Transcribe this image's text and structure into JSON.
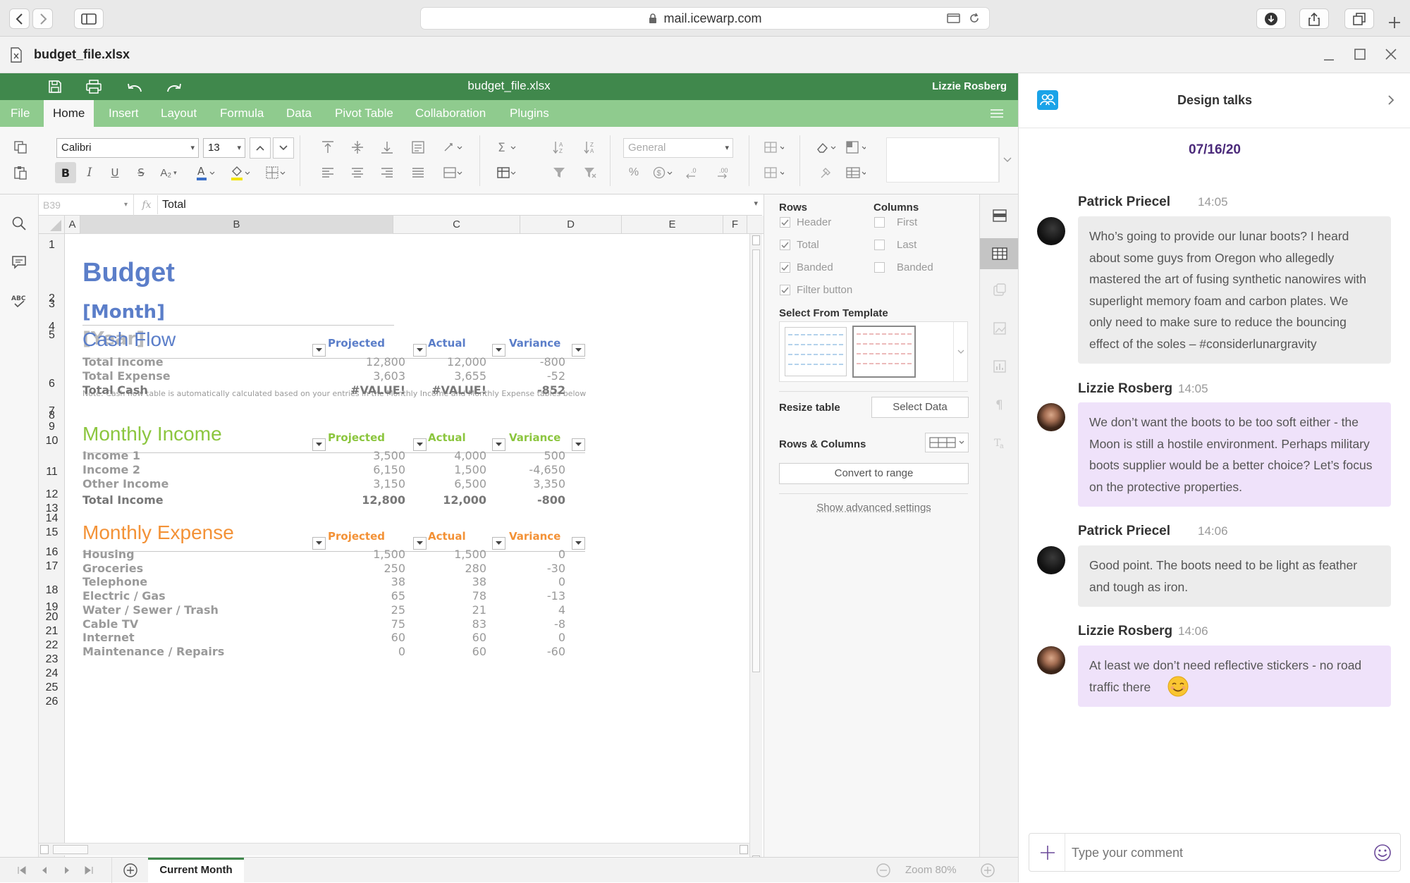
{
  "browser": {
    "url": "mail.icewarp.com"
  },
  "app": {
    "file_name": "budget_file.xlsx"
  },
  "editor": {
    "title": "budget_file.xlsx",
    "user": "Lizzie Rosberg",
    "tabs": [
      "File",
      "Home",
      "Insert",
      "Layout",
      "Formula",
      "Data",
      "Pivot Table",
      "Collaboration",
      "Plugins"
    ],
    "active_tab": "Home",
    "font_name": "Calibri",
    "font_size": "13",
    "number_format": "General",
    "cell_ref": "B39",
    "fx_label": "fx",
    "formula_value": "Total"
  },
  "columns": [
    "A",
    "B",
    "C",
    "D",
    "E",
    "F"
  ],
  "rows": [
    "1",
    "2",
    "3",
    "4",
    "5",
    "6",
    "7",
    "8",
    "9",
    "10",
    "11",
    "12",
    "13",
    "14",
    "15",
    "16",
    "17",
    "18",
    "19",
    "20",
    "21",
    "22",
    "23",
    "24",
    "25",
    "26"
  ],
  "sheet": {
    "title": "Budget",
    "month": "[Month]",
    "year": "[Year]",
    "note": "Note: Cash flow table is automatically calculated based on your entries in the Monthly Income and Monthly Expense tables below",
    "col_projected": "Projected",
    "col_actual": "Actual",
    "col_variance": "Variance",
    "cash_flow": {
      "title": "Cash Flow",
      "rows": [
        {
          "label": "Total Income",
          "projected": "12,800",
          "actual": "12,000",
          "variance": "-800"
        },
        {
          "label": "Total Expense",
          "projected": "3,603",
          "actual": "3,655",
          "variance": "-52"
        },
        {
          "label": "Total Cash",
          "projected": "#VALUE!",
          "actual": "#VALUE!",
          "variance": "-852"
        }
      ]
    },
    "income": {
      "title": "Monthly Income",
      "rows": [
        {
          "label": "Income 1",
          "projected": "3,500",
          "actual": "4,000",
          "variance": "500"
        },
        {
          "label": "Income 2",
          "projected": "6,150",
          "actual": "1,500",
          "variance": "-4,650"
        },
        {
          "label": "Other Income",
          "projected": "3,150",
          "actual": "6,500",
          "variance": "3,350"
        }
      ],
      "total": {
        "label": "Total Income",
        "projected": "12,800",
        "actual": "12,000",
        "variance": "-800"
      }
    },
    "expense": {
      "title": "Monthly Expense",
      "rows": [
        {
          "label": "Housing",
          "projected": "1,500",
          "actual": "1,500",
          "variance": "0"
        },
        {
          "label": "Groceries",
          "projected": "250",
          "actual": "280",
          "variance": "-30"
        },
        {
          "label": "Telephone",
          "projected": "38",
          "actual": "38",
          "variance": "0"
        },
        {
          "label": "Electric / Gas",
          "projected": "65",
          "actual": "78",
          "variance": "-13"
        },
        {
          "label": "Water / Sewer / Trash",
          "projected": "25",
          "actual": "21",
          "variance": "4"
        },
        {
          "label": "Cable TV",
          "projected": "75",
          "actual": "83",
          "variance": "-8"
        },
        {
          "label": "Internet",
          "projected": "60",
          "actual": "60",
          "variance": "0"
        },
        {
          "label": "Maintenance / Repairs",
          "projected": "0",
          "actual": "60",
          "variance": "-60"
        }
      ]
    },
    "colors": {
      "blue": "#5b7ec9",
      "green": "#8cc63f",
      "orange": "#f39237",
      "gray": "#9a9a9a"
    }
  },
  "settings": {
    "rows_title": "Rows",
    "columns_title": "Columns",
    "rows_options": [
      {
        "label": "Header",
        "checked": true
      },
      {
        "label": "Total",
        "checked": true
      },
      {
        "label": "Banded",
        "checked": true
      },
      {
        "label": "Filter button",
        "checked": true
      }
    ],
    "columns_options": [
      {
        "label": "First",
        "checked": false
      },
      {
        "label": "Last",
        "checked": false
      },
      {
        "label": "Banded",
        "checked": false
      }
    ],
    "template_title": "Select From Template",
    "resize_title": "Resize table",
    "select_data": "Select Data",
    "rows_columns_title": "Rows & Columns",
    "convert": "Convert to range",
    "advanced": "Show advanced settings"
  },
  "bottom": {
    "sheet_tab": "Current Month",
    "zoom": "Zoom 80%"
  },
  "chat": {
    "title": "Design talks",
    "date": "07/16/20",
    "messages": [
      {
        "author": "Patrick Priecel",
        "time": "14:05",
        "lines": [
          "Who’s going to provide our lunar boots? I heard",
          "about some guys from Oregon who allegedly",
          "mastered the art of fusing synthetic nanowires with",
          "superlight memory foam and carbon plates. We",
          "only need to make sure to reduce the bouncing",
          "effect of the soles – #considerlunargravity"
        ]
      },
      {
        "author": "Lizzie Rosberg",
        "time": "14:05",
        "lines": [
          "We don’t want the boots to be too soft either - the",
          "Moon is still a hostile environment. Perhaps military",
          "boots supplier would be a better choice? Let’s focus",
          "on the protective properties."
        ]
      },
      {
        "author": "Patrick Priecel",
        "time": "14:06",
        "lines": [
          "Good point. The boots need to be light as feather",
          "and tough as iron."
        ]
      },
      {
        "author": "Lizzie Rosberg",
        "time": "14:06",
        "lines": [
          "At least we don’t need reflective stickers - no road",
          "traffic there"
        ]
      }
    ],
    "input_placeholder": "Type your comment",
    "colors": {
      "bubble_gray": "#ececec",
      "bubble_purple": "#efe2fa",
      "date": "#4b2a7a"
    }
  }
}
